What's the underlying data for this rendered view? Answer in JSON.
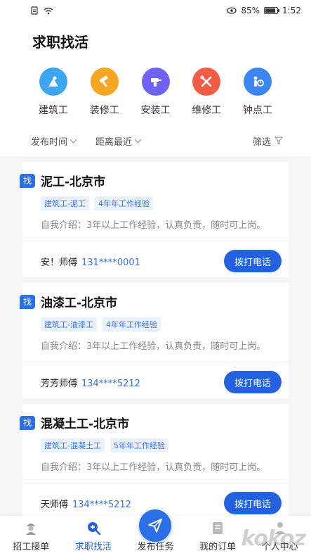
{
  "status": {
    "battery": "85%",
    "time": "1:52"
  },
  "header": {
    "title": "求职找活"
  },
  "categories": [
    {
      "label": "建筑工",
      "color": "#3aa7f0",
      "icon": "construction-worker-icon"
    },
    {
      "label": "装修工",
      "color": "#f5a623",
      "icon": "paint-roller-icon"
    },
    {
      "label": "安装工",
      "color": "#6f63f5",
      "icon": "drill-icon"
    },
    {
      "label": "维修工",
      "color": "#f25c45",
      "icon": "tools-icon"
    },
    {
      "label": "钟点工",
      "color": "#3d86f2",
      "icon": "hourly-worker-icon"
    }
  ],
  "filters": {
    "publish_time": "发布时间",
    "distance": "距离最近",
    "filter": "筛选"
  },
  "jobs": [
    {
      "badge": "找",
      "title": "泥工-北京市",
      "tags": [
        "建筑工-泥工",
        "4年年工作经验"
      ],
      "intro": "自我介绍：3年以上工作经验，认真负责，随时可上岗。",
      "contact": "安！师傅",
      "phone": "131****0001",
      "button": "拨打电话"
    },
    {
      "badge": "找",
      "title": "油漆工-北京市",
      "tags": [
        "建筑工-油漆工",
        "4年年工作经验"
      ],
      "intro": "自我介绍：3年以上工作经验，认真负责，随时可上岗。",
      "contact": "芳芳师傅",
      "phone": "134****5212",
      "button": "拨打电话"
    },
    {
      "badge": "找",
      "title": "混凝土工-北京市",
      "tags": [
        "建筑工-混凝土工",
        "5年年工作经验"
      ],
      "intro": "自我介绍：3年以上工作经验，认真负责，随时可上岗。",
      "contact": "天师傅",
      "phone": "134****5212",
      "button": "拨打电话"
    }
  ],
  "tabs": [
    {
      "label": "招工接单"
    },
    {
      "label": "求职找活"
    },
    {
      "label": "发布任务"
    },
    {
      "label": "我的订单"
    },
    {
      "label": "个人中心"
    }
  ],
  "watermark": "kokoz"
}
